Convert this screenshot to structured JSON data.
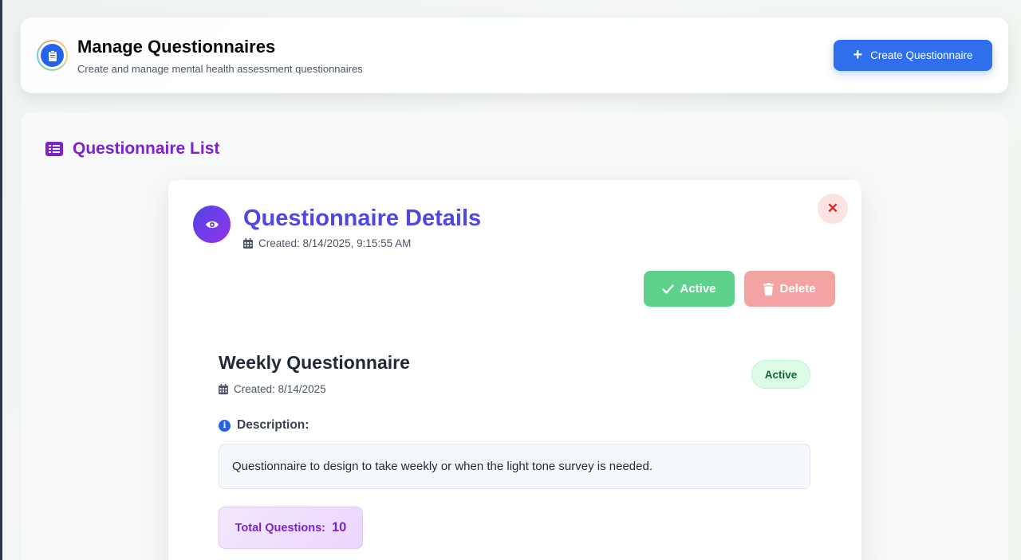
{
  "header": {
    "title": "Manage Questionnaires",
    "subtitle": "Create and manage mental health assessment questionnaires",
    "create_label": "Create Questionnaire"
  },
  "list": {
    "title": "Questionnaire List"
  },
  "modal": {
    "title": "Questionnaire Details",
    "created": "Created: 8/14/2025, 9:15:55 AM",
    "close_symbol": "✕",
    "active_label": "Active",
    "delete_label": "Delete",
    "questionnaire": {
      "name": "Weekly Questionnaire",
      "created": "Created: 8/14/2025",
      "status": "Active",
      "description_label": "Description:",
      "description": "Questionnaire to design to take weekly or when the light tone survey is needed.",
      "total_label": "Total Questions:",
      "total_value": "10"
    }
  },
  "colors": {
    "primary": "#2f6fec",
    "accent_purple": "#7e22ce",
    "title_indigo": "#4f46e5",
    "active_green": "#5ed18c",
    "delete_red": "#f4a3a3"
  },
  "icons": [
    "clipboard-icon",
    "plus-icon",
    "list-icon",
    "eye-icon",
    "calendar-icon",
    "close-icon",
    "check-icon",
    "trash-icon",
    "info-icon"
  ]
}
